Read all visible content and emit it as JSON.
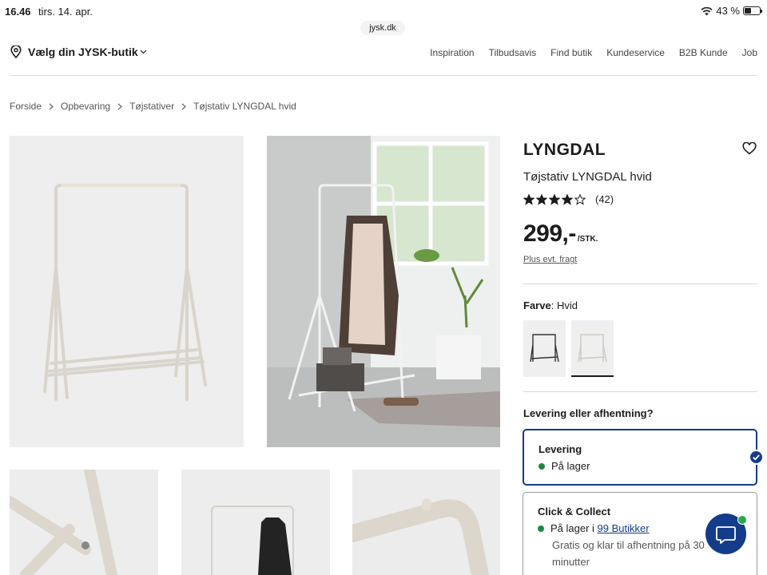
{
  "status_bar": {
    "time": "16.46",
    "date": "tirs. 14. apr.",
    "battery": "43 %",
    "battery_level": 0.43
  },
  "browser": {
    "url": "jysk.dk"
  },
  "header": {
    "store_select": "Vælg din JYSK-butik",
    "nav": [
      "Inspiration",
      "Tilbudsavis",
      "Find butik",
      "Kundeservice",
      "B2B Kunde",
      "Job"
    ]
  },
  "breadcrumb": [
    "Forside",
    "Opbevaring",
    "Tøjstativer",
    "Tøjstativ LYNGDAL hvid"
  ],
  "product": {
    "name": "LYNGDAL",
    "subtitle": "Tøjstativ LYNGDAL hvid",
    "rating": 4,
    "rating_max": 5,
    "review_count": "(42)",
    "price": "299,-",
    "price_unit": "/STK.",
    "freight_link": "Plus evt. fragt",
    "color_label": "Farve",
    "color_value": "Hvid",
    "swatches": [
      {
        "name": "black",
        "selected": false
      },
      {
        "name": "white",
        "selected": true
      }
    ]
  },
  "delivery": {
    "question": "Levering eller afhentning?",
    "options": [
      {
        "title": "Levering",
        "status": "På lager",
        "selected": true
      },
      {
        "title": "Click & Collect",
        "status_prefix": "På lager i ",
        "status_link": "99 Butikker",
        "note": "Gratis og klar til afhentning på 30 minutter",
        "selected": false
      }
    ]
  },
  "colors": {
    "primary": "#143c8a",
    "in_stock": "#1a8a3c",
    "text": "#1b1b1b"
  }
}
